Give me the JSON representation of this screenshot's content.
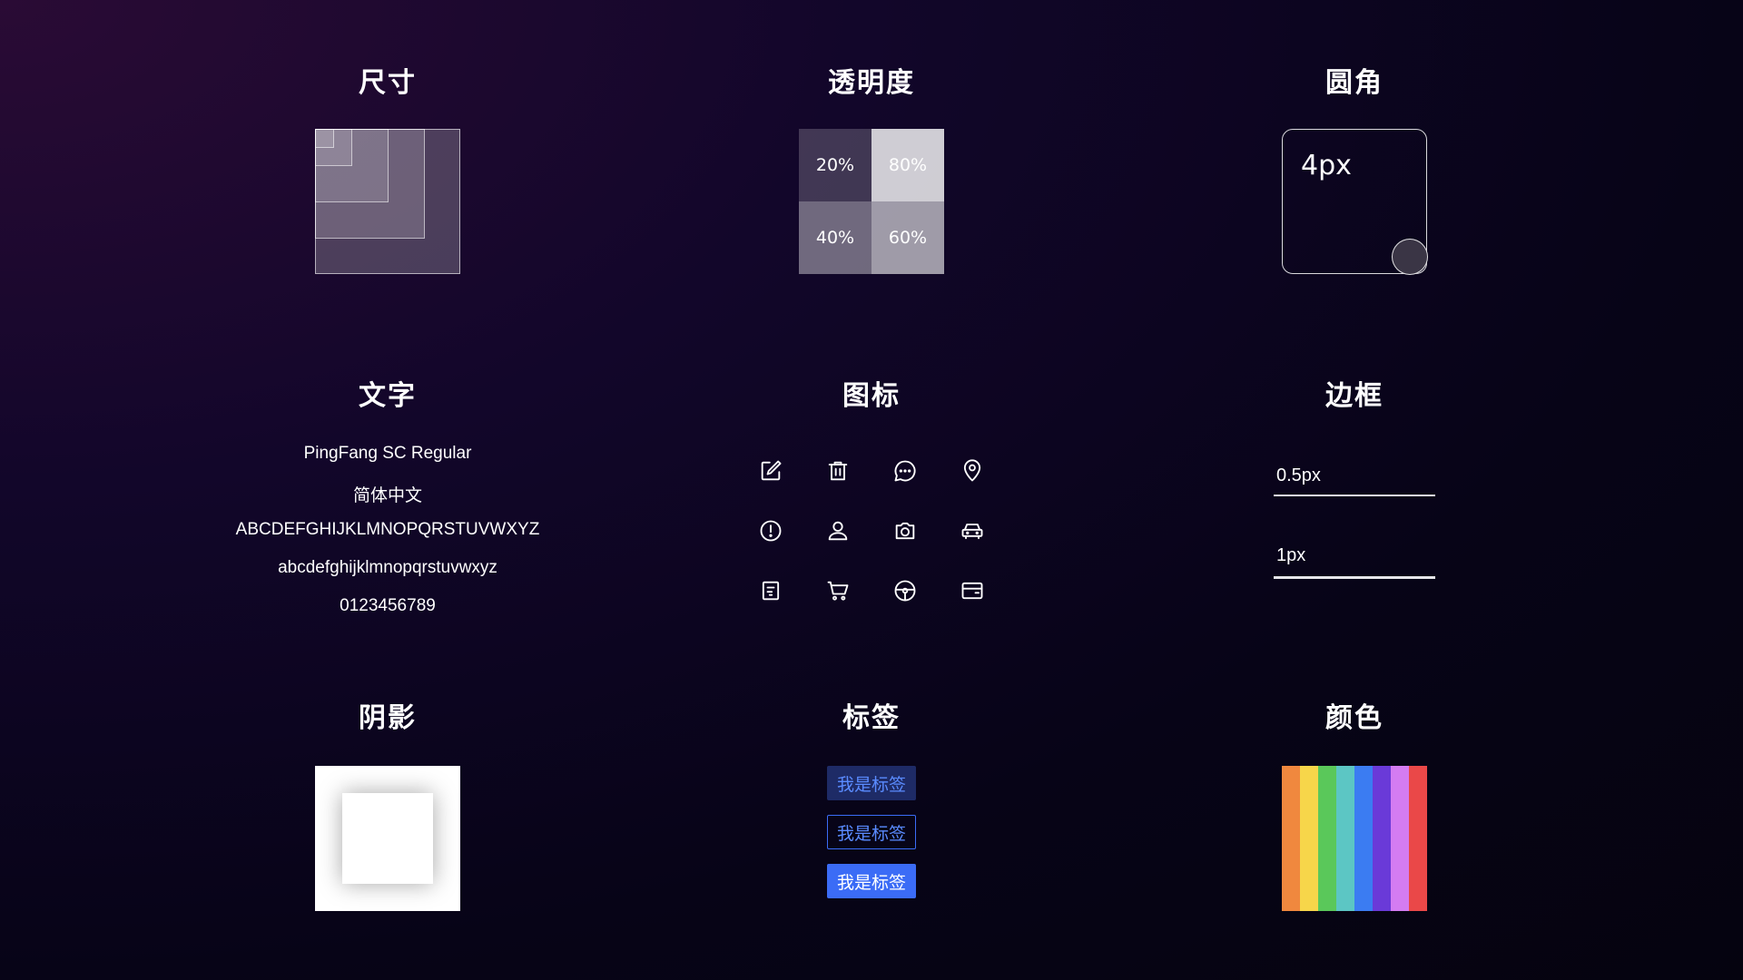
{
  "sections": {
    "size": {
      "title": "尺寸"
    },
    "opacity": {
      "title": "透明度",
      "cells": [
        "20%",
        "80%",
        "40%",
        "60%"
      ]
    },
    "radius": {
      "title": "圆角",
      "label": "4px"
    },
    "text": {
      "title": "文字",
      "lines": [
        "PingFang SC Regular",
        "简体中文",
        "ABCDEFGHIJKLMNOPQRSTUVWXYZ",
        "abcdefghijklmnopqrstuvwxyz",
        "0123456789"
      ]
    },
    "icons": {
      "title": "图标",
      "items": [
        "edit-icon",
        "trash-icon",
        "chat-bubble-icon",
        "location-pin-icon",
        "alert-circle-icon",
        "user-icon",
        "camera-icon",
        "car-icon",
        "document-icon",
        "shopping-cart-icon",
        "steering-wheel-icon",
        "wallet-card-icon"
      ]
    },
    "border": {
      "title": "边框",
      "labels": [
        "0.5px",
        "1px"
      ]
    },
    "shadow": {
      "title": "阴影"
    },
    "tags": {
      "title": "标签",
      "labels": [
        "我是标签",
        "我是标签",
        "我是标签"
      ],
      "colors": {
        "accent": "#3b6cf6"
      }
    },
    "color": {
      "title": "颜色",
      "swatches": [
        "#f0883e",
        "#f7d64a",
        "#5ac85a",
        "#5cc6c4",
        "#3b7cf2",
        "#6a3ad8",
        "#d47cf2",
        "#ea4848"
      ]
    }
  }
}
